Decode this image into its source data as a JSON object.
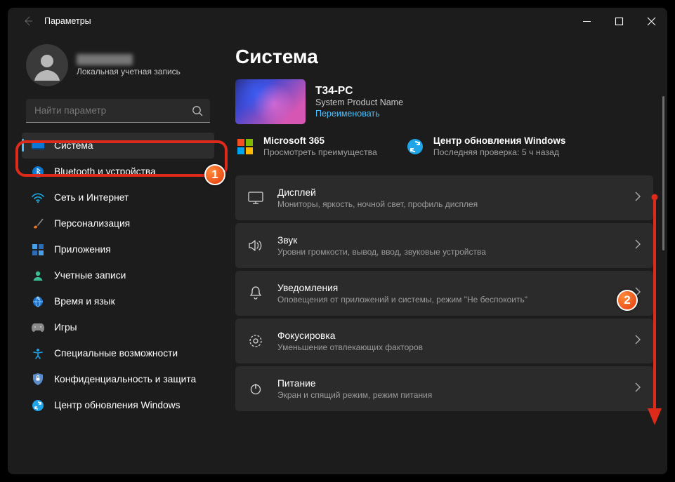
{
  "window": {
    "title": "Параметры"
  },
  "account": {
    "name_blurred": "",
    "subtitle": "Локальная учетная запись"
  },
  "search": {
    "placeholder": "Найти параметр"
  },
  "sidebar": {
    "items": [
      {
        "label": "Система",
        "icon": "system"
      },
      {
        "label": "Bluetooth и устройства",
        "icon": "bluetooth"
      },
      {
        "label": "Сеть и Интернет",
        "icon": "network"
      },
      {
        "label": "Персонализация",
        "icon": "personalize"
      },
      {
        "label": "Приложения",
        "icon": "apps"
      },
      {
        "label": "Учетные записи",
        "icon": "accounts"
      },
      {
        "label": "Время и язык",
        "icon": "time"
      },
      {
        "label": "Игры",
        "icon": "gaming"
      },
      {
        "label": "Специальные возможности",
        "icon": "accessibility"
      },
      {
        "label": "Конфиденциальность и защита",
        "icon": "privacy"
      },
      {
        "label": "Центр обновления Windows",
        "icon": "update"
      }
    ]
  },
  "main": {
    "title": "Система",
    "device": {
      "name": "T34-PC",
      "sub": "System Product Name",
      "rename": "Переименовать"
    },
    "cards": {
      "m365": {
        "title": "Microsoft 365",
        "sub": "Просмотреть преимущества"
      },
      "update": {
        "title": "Центр обновления Windows",
        "sub": "Последняя проверка: 5 ч назад"
      }
    },
    "items": [
      {
        "title": "Дисплей",
        "sub": "Мониторы, яркость, ночной свет, профиль дисплея",
        "icon": "display"
      },
      {
        "title": "Звук",
        "sub": "Уровни громкости, вывод, ввод, звуковые устройства",
        "icon": "sound"
      },
      {
        "title": "Уведомления",
        "sub": "Оповещения от приложений и системы, режим \"Не беспокоить\"",
        "icon": "bell"
      },
      {
        "title": "Фокусировка",
        "sub": "Уменьшение отвлекающих факторов",
        "icon": "focus"
      },
      {
        "title": "Питание",
        "sub": "Экран и спящий режим, режим питания",
        "icon": "power"
      }
    ]
  },
  "colors": {
    "accent": "#4cc2ff",
    "annotation": "#de2a1b"
  }
}
